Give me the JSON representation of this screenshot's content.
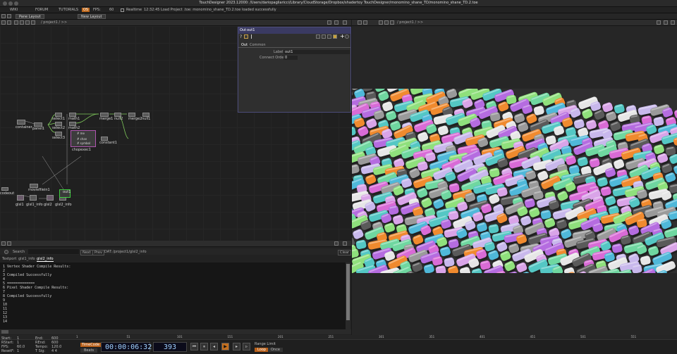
{
  "window": {
    "title": "TouchDesigner 2023.12000: /Users/dariopagliaricci/Library/CloudStorage/Dropbox/shadertoy TouchDesigner/monomino_shane_TD/monomino_shane_TD.2.toe"
  },
  "menubar": {
    "items": [
      "WIKI",
      "FORUM",
      "TUTORIALS"
    ],
    "badge": "OS",
    "fps_label": "FPS:",
    "fps_value": "60",
    "realtime": "Realtime",
    "status": "12:32:45 Load Project .toe: monomino_shane_TD.2.toe loaded successfully"
  },
  "toolbar": {
    "pane_layout": "Pane Layout",
    "new_layout": "New Layout"
  },
  "network": {
    "path": "/ project1 / >>",
    "nodes": [
      {
        "id": "select1",
        "label": "select1"
      },
      {
        "id": "math1",
        "label": "math1"
      },
      {
        "id": "select2",
        "label": "select2"
      },
      {
        "id": "math2",
        "label": "math2"
      },
      {
        "id": "select3",
        "label": "select3"
      },
      {
        "id": "merge1",
        "label": "merge1"
      },
      {
        "id": "null2",
        "label": "null2"
      },
      {
        "id": "merge2",
        "label": "merge2"
      },
      {
        "id": "null1",
        "label": "null1"
      },
      {
        "id": "container",
        "label": "container"
      },
      {
        "id": "panel1",
        "label": "panel1"
      },
      {
        "id": "chopexec1",
        "label": "chopexec1"
      },
      {
        "id": "constant1",
        "label": "constant1"
      },
      {
        "id": "moviefilein1",
        "label": "moviefilein1"
      },
      {
        "id": "codeout",
        "label": "codeout"
      },
      {
        "id": "glsl1",
        "label": "glsl1"
      },
      {
        "id": "glsl1_info",
        "label": "glsl1_info"
      },
      {
        "id": "glsl2",
        "label": "glsl2"
      },
      {
        "id": "glsl2_info",
        "label": "glsl2_info"
      },
      {
        "id": "out1",
        "label": "out1"
      }
    ],
    "chopexec_lines": [
      "# me",
      "# chan",
      "# symbol"
    ]
  },
  "param": {
    "op_type": "Out",
    "op_name": "out1",
    "tabs": [
      "Out",
      "Common"
    ],
    "label_name": "Label",
    "label_value": "out1",
    "connect_name": "Connect Order",
    "connect_value": "0"
  },
  "textport": {
    "search_label": "Search",
    "next": "Next",
    "prev": "Prev",
    "dat_label": "DAT:",
    "dat_path": "/project1/glsl2_info",
    "clear": "Clear",
    "tabs": [
      "Textport",
      "glsl1_info",
      "glsl2_info"
    ],
    "lines": [
      "1 Vertex Shader Compile Results:",
      "2",
      "3 Compiled Successfully",
      "4",
      "5 =============",
      "6 Pixel Shader Compile Results:",
      "7",
      "8 Compiled Successfully",
      "9",
      "10",
      "11",
      "12",
      "13",
      "14"
    ]
  },
  "viewer": {
    "path": "/ project1 / >>",
    "tile_colors": [
      "#f08a2e",
      "#54c7c4",
      "#8fe07c",
      "#d9a4e8",
      "#b56ce0",
      "#e6e6e6",
      "#9a9a9a",
      "#5a5a5a",
      "#d96bd6",
      "#6fd7a0",
      "#c8b8ec",
      "#4fb8d9"
    ]
  },
  "timeline": {
    "stats_left": [
      {
        "k": "Start:",
        "v": "1"
      },
      {
        "k": "RStart:",
        "v": "1"
      },
      {
        "k": "FPS:",
        "v": "60.0"
      },
      {
        "k": "ResetF:",
        "v": "1"
      }
    ],
    "stats_right": [
      {
        "k": "End:",
        "v": "600"
      },
      {
        "k": "REnd:",
        "v": "600"
      },
      {
        "k": "Tempo:",
        "v": "120.0"
      },
      {
        "k": "T Sig:",
        "v": "4    4"
      }
    ],
    "timecode_label": "TimeCode",
    "beats_label": "Beats",
    "timecode": "00:00:06:32",
    "frame": "393",
    "range_label": "Range Limit",
    "loop": "Loop",
    "once": "Once",
    "ruler": [
      "1",
      "51",
      "101",
      "151",
      "201",
      "251",
      "301",
      "351",
      "401",
      "451",
      "501",
      "551"
    ]
  }
}
